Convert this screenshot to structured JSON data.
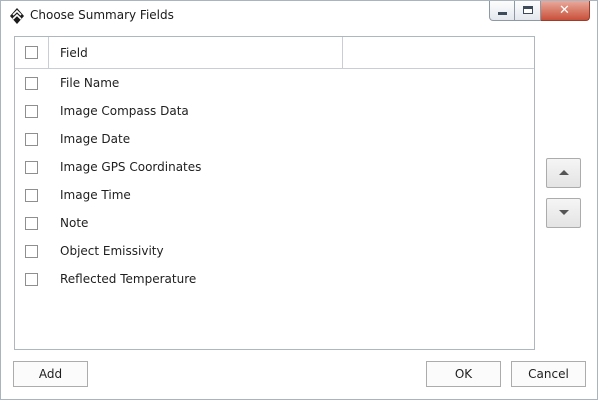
{
  "window": {
    "title": "Choose Summary Fields",
    "icon": "app-diamond-icon"
  },
  "list": {
    "header": {
      "field_label": "Field",
      "select_all_checked": false
    },
    "items": [
      {
        "label": "File Name",
        "checked": false
      },
      {
        "label": "Image Compass Data",
        "checked": false
      },
      {
        "label": "Image Date",
        "checked": false
      },
      {
        "label": "Image GPS Coordinates",
        "checked": false
      },
      {
        "label": "Image Time",
        "checked": false
      },
      {
        "label": "Note",
        "checked": false
      },
      {
        "label": "Object Emissivity",
        "checked": false
      },
      {
        "label": "Reflected Temperature",
        "checked": false
      }
    ]
  },
  "side_buttons": {
    "up_icon": "arrow-up-icon",
    "down_icon": "arrow-down-icon"
  },
  "footer": {
    "add_label": "Add",
    "ok_label": "OK",
    "cancel_label": "Cancel"
  }
}
